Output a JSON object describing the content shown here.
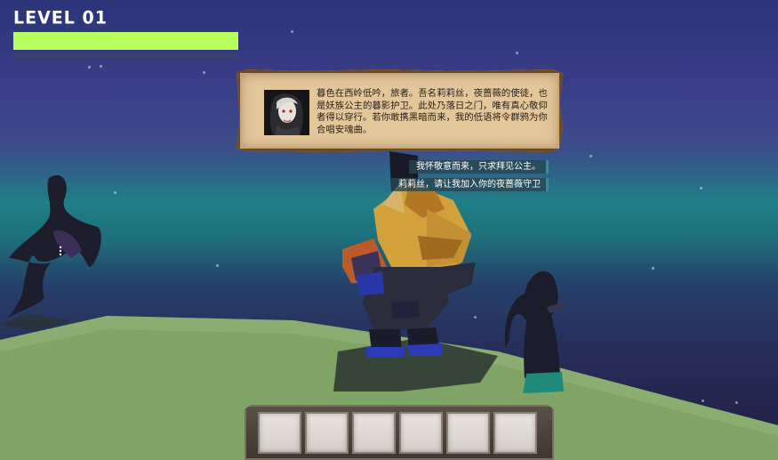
{
  "hud": {
    "level_label": "LEVEL 01",
    "health_fraction": 1.0,
    "health_color": "#b6ff5d"
  },
  "dialog": {
    "portrait_icon": "npc-portrait",
    "text": "暮色在西岭低吟，旅者。吾名莉莉丝，夜蔷薇的使徒，也是妖族公主的暮影护卫。此处乃落日之门，唯有真心敬仰者得以穿行。若你敢携黑暗而来，我的低语将令群鸦为你合唱安魂曲。"
  },
  "choices": [
    {
      "label": "我怀敬意而来，只求拜见公主。"
    },
    {
      "label": "莉莉丝，请让我加入你的夜蔷薇守卫"
    }
  ],
  "inventory": {
    "slots": [
      {
        "item": ""
      },
      {
        "item": ""
      },
      {
        "item": ""
      },
      {
        "item": ""
      },
      {
        "item": ""
      },
      {
        "item": ""
      }
    ]
  },
  "colors": {
    "sky_top": "#2b3578",
    "sky_teal": "#1f7f86",
    "ground": "#7fa566",
    "dialog_parchment": "#e2c79b",
    "dialog_border": "#6b4a2a"
  }
}
